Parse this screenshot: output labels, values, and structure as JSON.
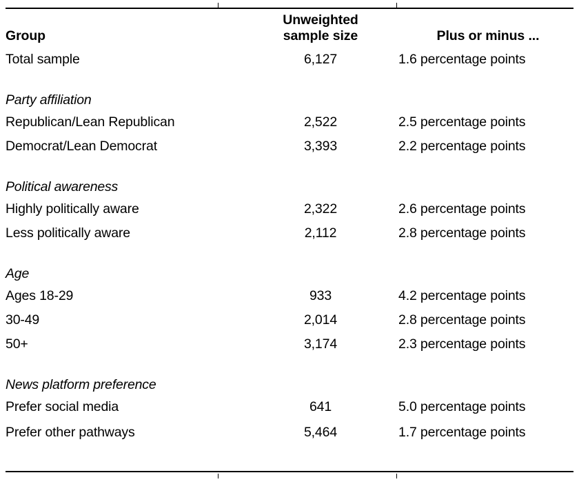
{
  "table": {
    "headers": {
      "group": "Group",
      "sample_size_line1": "Unweighted",
      "sample_size_line2": "sample size",
      "margin_of_error": "Plus or minus ..."
    },
    "rows": [
      {
        "kind": "data",
        "group": "Total sample",
        "n": "6,127",
        "moe": "1.6 percentage points"
      },
      {
        "kind": "section",
        "group": "Party affiliation",
        "n": "",
        "moe": ""
      },
      {
        "kind": "data",
        "group": "Republican/Lean Republican",
        "n": "2,522",
        "moe": "2.5 percentage points"
      },
      {
        "kind": "data",
        "group": "Democrat/Lean Democrat",
        "n": "3,393",
        "moe": "2.2 percentage points"
      },
      {
        "kind": "section",
        "group": "Political awareness",
        "n": "",
        "moe": ""
      },
      {
        "kind": "data",
        "group": "Highly politically aware",
        "n": "2,322",
        "moe": "2.6 percentage points"
      },
      {
        "kind": "data",
        "group": "Less politically aware",
        "n": "2,112",
        "moe": "2.8 percentage points"
      },
      {
        "kind": "section",
        "group": "Age",
        "n": "",
        "moe": ""
      },
      {
        "kind": "data",
        "group": "Ages 18-29",
        "n": "933",
        "moe": "4.2 percentage points"
      },
      {
        "kind": "data",
        "group": "30-49",
        "n": "2,014",
        "moe": "2.8 percentage points"
      },
      {
        "kind": "data",
        "group": "50+",
        "n": "3,174",
        "moe": "2.3 percentage points"
      },
      {
        "kind": "section",
        "group": "News platform preference",
        "n": "",
        "moe": ""
      },
      {
        "kind": "data",
        "group": "Prefer social media",
        "n": "641",
        "moe": "5.0 percentage points"
      },
      {
        "kind": "data",
        "group": "Prefer other pathways",
        "n": "5,464",
        "moe": "1.7 percentage points"
      }
    ]
  },
  "colors": {
    "text": "#000000",
    "rule": "#000000",
    "background": "#ffffff"
  }
}
